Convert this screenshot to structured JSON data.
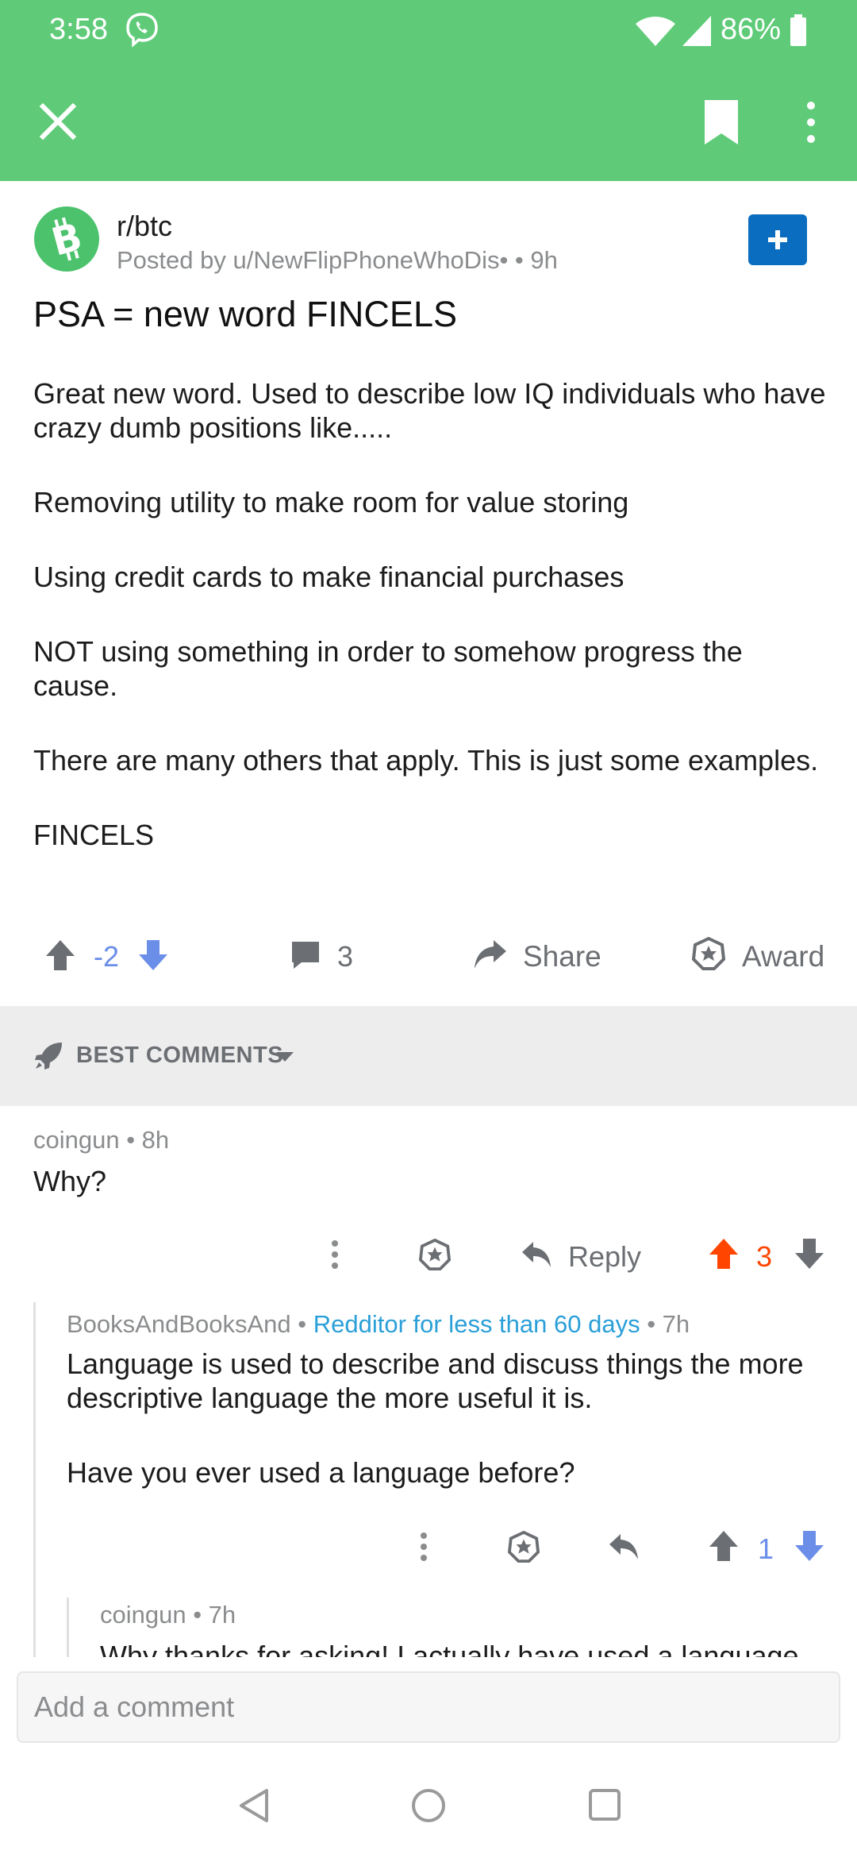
{
  "status_bar": {
    "time": "3:58",
    "battery": "86%"
  },
  "post": {
    "subreddit": "r/btc",
    "meta": "Posted by u/NewFlipPhoneWhoDis• • 9h",
    "title": "PSA = new word FINCELS",
    "body": [
      "Great new word.  Used to describe low IQ individuals who have crazy dumb positions like.....",
      "Removing utility to make room for value storing",
      "Using credit cards to make financial purchases",
      "NOT using something in order to somehow progress the cause.",
      "There are many others that apply.  This is just some examples.",
      "FINCELS"
    ],
    "score": "-2",
    "comment_count": "3",
    "share_label": "Share",
    "award_label": "Award"
  },
  "sort": {
    "label": "BEST COMMENTS"
  },
  "comments": [
    {
      "author": "coingun",
      "time": "• 8h",
      "body": [
        "Why?"
      ],
      "reply_label": "Reply",
      "score": "3"
    },
    {
      "author": "BooksAndBooksAnd",
      "sep": " • ",
      "flair": "Redditor for less than 60 days",
      "time": " • 7h",
      "body": [
        "Language is used to describe and discuss things the more descriptive language the more useful it is.",
        "Have you ever used a language before?"
      ],
      "score": "1"
    },
    {
      "author": "coingun",
      "time": "• 7h",
      "body_partial": "Why thanks for asking! I actually have used a language"
    }
  ],
  "composer": {
    "placeholder": "Add a comment"
  },
  "colors": {
    "app_bar": "#5fcb78",
    "join_button": "#0a6dbf",
    "upvoted": "#ff4500",
    "downvoted_blue": "#6b8ee8",
    "flair": "#2a9fd8"
  },
  "icons": [
    "viber-icon",
    "wifi-icon",
    "signal-icon",
    "battery-icon",
    "close-icon",
    "bookmark-icon",
    "more-vert-icon",
    "bitcoin-cash-icon",
    "plus-icon",
    "upvote-icon",
    "downvote-icon",
    "comment-icon",
    "share-icon",
    "award-icon",
    "rocket-icon",
    "caret-down-icon",
    "reply-icon",
    "nav-back-icon",
    "nav-home-icon",
    "nav-recents-icon"
  ]
}
